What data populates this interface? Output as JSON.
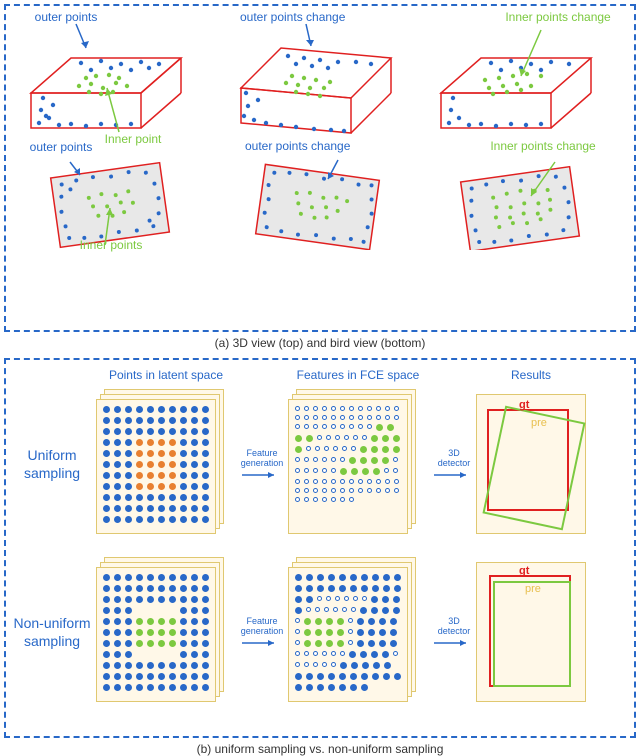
{
  "panelA": {
    "caption": "(a) 3D view (top) and bird view (bottom)",
    "labels": {
      "outer_points": "outer points",
      "inner_point": "Inner point",
      "outer_points_change": "outer points change",
      "inner_points_change": "Inner points change",
      "inner_points": "Inner points"
    },
    "colors": {
      "outer": "#2868c8",
      "inner": "#7cc940",
      "box_stroke": "#e02020"
    }
  },
  "panelB": {
    "caption": "(b) uniform sampling  vs. non-uniform sampling",
    "col_headers": {
      "latent": "Points in latent space",
      "fce": "Features in FCE space",
      "results": "Results"
    },
    "rows": [
      {
        "label": "Uniform sampling",
        "key": "uniform"
      },
      {
        "label": "Non-uniform sampling",
        "key": "nonuniform"
      }
    ],
    "process_labels": {
      "feature_gen": "Feature generation",
      "detector": "3D detector"
    },
    "result_labels": {
      "gt": "gt",
      "pre": "pre"
    },
    "colors": {
      "card_bg": "#fff8e8",
      "card_border": "#e0c870",
      "gt": "#e02020",
      "pre": "#7cc940",
      "pre_label": "#e8c050",
      "text": "#2868c8"
    }
  }
}
